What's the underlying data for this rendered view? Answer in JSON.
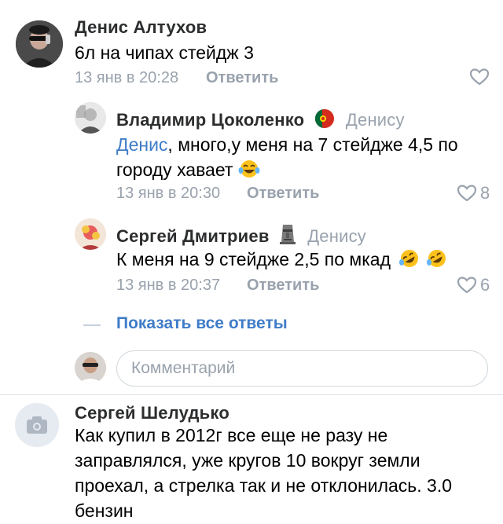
{
  "comments": [
    {
      "author": "Денис Алтухов",
      "text": "6л на чипах стейдж 3",
      "date": "13 янв в 20:28",
      "reply_label": "Ответить",
      "likes": ""
    }
  ],
  "replies": [
    {
      "author": "Владимир Цоколенко",
      "reply_to": "Денису",
      "mention": "Денис",
      "text_line1": ", много,у меня на 7 стейдже 4,5 по",
      "text_line2": "городу хавает",
      "date": "13 янв в 20:30",
      "reply_label": "Ответить",
      "likes": "8"
    },
    {
      "author": "Сергей Дмитриев",
      "reply_to": "Денису",
      "text": "К меня на 9 стейдже 2,5 по мкад",
      "date": "13 янв в 20:37",
      "reply_label": "Ответить",
      "likes": "6"
    }
  ],
  "show_all_replies": "Показать все ответы",
  "comment_input": {
    "placeholder": "Комментарий"
  },
  "last_comment": {
    "author": "Сергей Шелудько",
    "text_lines": [
      "Как купил в 2012г все еще не разу не",
      "заправлялся, уже кругов 10 вокруг земли",
      "проехал, а стрелка так и не отклонилась. 3.0",
      "бензин"
    ]
  },
  "colors": {
    "accent": "#3f7cc8",
    "secondary_text": "#99a2ad",
    "author_text": "#2c2d2e"
  }
}
